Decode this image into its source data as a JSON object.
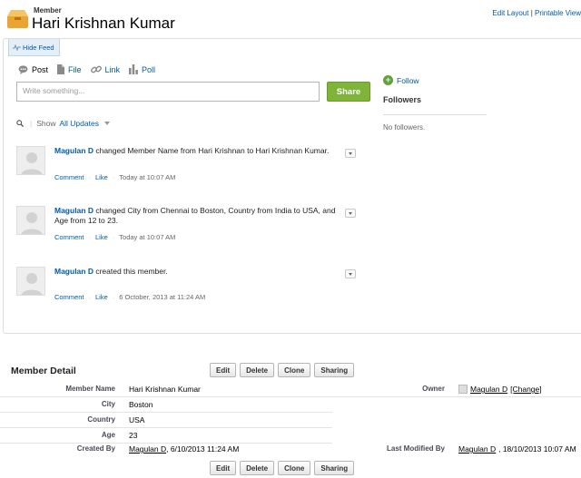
{
  "header": {
    "object_type": "Member",
    "record_name": "Hari Krishnan Kumar",
    "edit_layout": "Edit Layout",
    "separator": "|",
    "printable_view": "Printable View"
  },
  "feed": {
    "hide_feed": "Hide Feed",
    "publisher_tabs": [
      {
        "label": "Post",
        "icon": "speech-bubble-icon"
      },
      {
        "label": "File",
        "icon": "file-icon"
      },
      {
        "label": "Link",
        "icon": "link-icon"
      },
      {
        "label": "Poll",
        "icon": "poll-icon"
      }
    ],
    "input_placeholder": "Write something...",
    "share_label": "Share",
    "filter_show": "Show",
    "filter_value": "All Updates",
    "posts": [
      {
        "actor": "Magulan D",
        "text": " changed Member Name from Hari Krishnan to Hari Krishnan Kumar.",
        "comment": "Comment",
        "like": "Like",
        "time": "Today at 10:07 AM"
      },
      {
        "actor": "Magulan D",
        "text": " changed City from Chennai to Boston, Country from India to USA, and Age from 12 to 23.",
        "comment": "Comment",
        "like": "Like",
        "time": "Today at 10:07 AM"
      },
      {
        "actor": "Magulan D",
        "text": " created this member.",
        "comment": "Comment",
        "like": "Like",
        "time": "6 October, 2013 at 11:24 AM"
      }
    ],
    "follow_label": "Follow",
    "followers_heading": "Followers",
    "no_followers": "No followers."
  },
  "detail": {
    "title": "Member Detail",
    "buttons": [
      "Edit",
      "Delete",
      "Clone",
      "Sharing"
    ],
    "fields": {
      "member_name_label": "Member Name",
      "member_name": "Hari Krishnan Kumar",
      "owner_label": "Owner",
      "owner": "Magulan D",
      "owner_change": "[Change]",
      "city_label": "City",
      "city": "Boston",
      "country_label": "Country",
      "country": "USA",
      "age_label": "Age",
      "age": "23",
      "created_by_label": "Created By",
      "created_by": "Magulan D",
      "created_date": ", 6/10/2013 11:24 AM",
      "modified_by_label": "Last Modified By",
      "modified_by": "Magulan D",
      "modified_date": ", 18/10/2013 10:07 AM"
    }
  },
  "colors": {
    "link": "#015ba7",
    "share_button": "#7fb339",
    "follow_icon": "#5fa33a"
  }
}
